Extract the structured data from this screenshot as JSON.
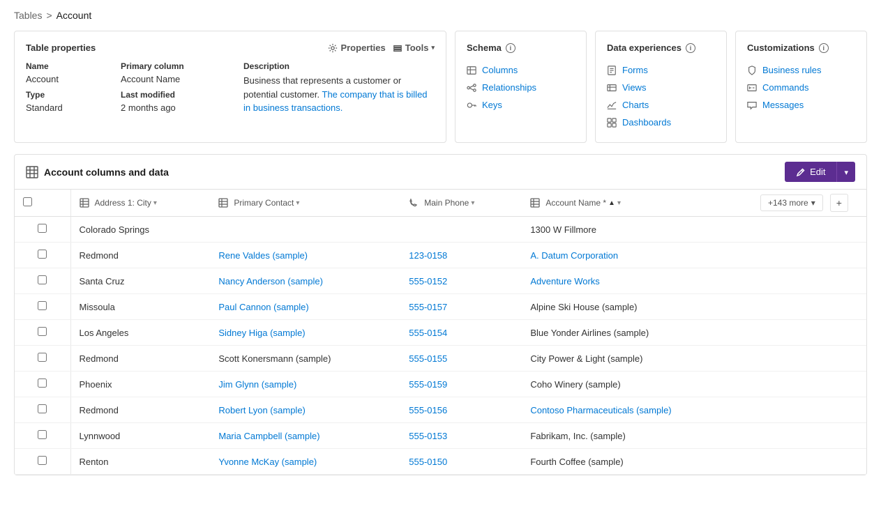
{
  "breadcrumb": {
    "parent": "Tables",
    "separator": ">",
    "current": "Account"
  },
  "tableProperties": {
    "sectionTitle": "Table properties",
    "propertiesBtn": "Properties",
    "toolsBtn": "Tools",
    "columns": {
      "name": {
        "label": "Name",
        "value": "Account"
      },
      "type": {
        "label": "Type",
        "value": "Standard"
      },
      "primaryColumn": {
        "label": "Primary column",
        "value": "Account Name"
      },
      "lastModified": {
        "label": "Last modified",
        "value": "2 months ago"
      },
      "description": {
        "label": "Description",
        "text1": "Business that represents a customer or potential customer. ",
        "linkText": "The company that is billed in business transactions.",
        "text2": ""
      }
    }
  },
  "schema": {
    "title": "Schema",
    "links": [
      {
        "id": "columns",
        "label": "Columns"
      },
      {
        "id": "relationships",
        "label": "Relationships"
      },
      {
        "id": "keys",
        "label": "Keys"
      }
    ]
  },
  "dataExperiences": {
    "title": "Data experiences",
    "links": [
      {
        "id": "forms",
        "label": "Forms"
      },
      {
        "id": "views",
        "label": "Views"
      },
      {
        "id": "charts",
        "label": "Charts"
      },
      {
        "id": "dashboards",
        "label": "Dashboards"
      }
    ]
  },
  "customizations": {
    "title": "Customizations",
    "links": [
      {
        "id": "business-rules",
        "label": "Business rules"
      },
      {
        "id": "commands",
        "label": "Commands"
      },
      {
        "id": "messages",
        "label": "Messages"
      }
    ]
  },
  "dataGrid": {
    "sectionTitle": "Account columns and data",
    "editBtn": "Edit",
    "moreColsBtn": "+143 more",
    "columns": [
      {
        "id": "checkbox",
        "label": ""
      },
      {
        "id": "city",
        "label": "Address 1: City",
        "icon": "grid",
        "sortable": true
      },
      {
        "id": "primaryContact",
        "label": "Primary Contact",
        "icon": "contact",
        "sortable": true
      },
      {
        "id": "mainPhone",
        "label": "Main Phone",
        "icon": "phone",
        "sortable": true
      },
      {
        "id": "accountName",
        "label": "Account Name *",
        "icon": "grid",
        "sortable": true,
        "ascending": true
      }
    ],
    "rows": [
      {
        "city": "Colorado Springs",
        "primaryContact": "",
        "mainPhone": "",
        "accountName": "1300 W Fillmore",
        "contactLink": false,
        "phoneLink": false,
        "nameLink": false
      },
      {
        "city": "Redmond",
        "primaryContact": "Rene Valdes (sample)",
        "mainPhone": "123-0158",
        "accountName": "A. Datum Corporation",
        "contactLink": true,
        "phoneLink": true,
        "nameLink": true
      },
      {
        "city": "Santa Cruz",
        "primaryContact": "Nancy Anderson (sample)",
        "mainPhone": "555-0152",
        "accountName": "Adventure Works",
        "contactLink": true,
        "phoneLink": true,
        "nameLink": true
      },
      {
        "city": "Missoula",
        "primaryContact": "Paul Cannon (sample)",
        "mainPhone": "555-0157",
        "accountName": "Alpine Ski House (sample)",
        "contactLink": true,
        "phoneLink": true,
        "nameLink": false
      },
      {
        "city": "Los Angeles",
        "primaryContact": "Sidney Higa (sample)",
        "mainPhone": "555-0154",
        "accountName": "Blue Yonder Airlines (sample)",
        "contactLink": true,
        "phoneLink": true,
        "nameLink": false
      },
      {
        "city": "Redmond",
        "primaryContact": "Scott Konersmann (sample)",
        "mainPhone": "555-0155",
        "accountName": "City Power & Light (sample)",
        "contactLink": false,
        "phoneLink": true,
        "nameLink": false
      },
      {
        "city": "Phoenix",
        "primaryContact": "Jim Glynn (sample)",
        "mainPhone": "555-0159",
        "accountName": "Coho Winery (sample)",
        "contactLink": true,
        "phoneLink": true,
        "nameLink": false
      },
      {
        "city": "Redmond",
        "primaryContact": "Robert Lyon (sample)",
        "mainPhone": "555-0156",
        "accountName": "Contoso Pharmaceuticals (sample)",
        "contactLink": true,
        "phoneLink": true,
        "nameLink": true
      },
      {
        "city": "Lynnwood",
        "primaryContact": "Maria Campbell (sample)",
        "mainPhone": "555-0153",
        "accountName": "Fabrikam, Inc. (sample)",
        "contactLink": true,
        "phoneLink": true,
        "nameLink": false
      },
      {
        "city": "Renton",
        "primaryContact": "Yvonne McKay (sample)",
        "mainPhone": "555-0150",
        "accountName": "Fourth Coffee (sample)",
        "contactLink": true,
        "phoneLink": true,
        "nameLink": false
      }
    ]
  }
}
